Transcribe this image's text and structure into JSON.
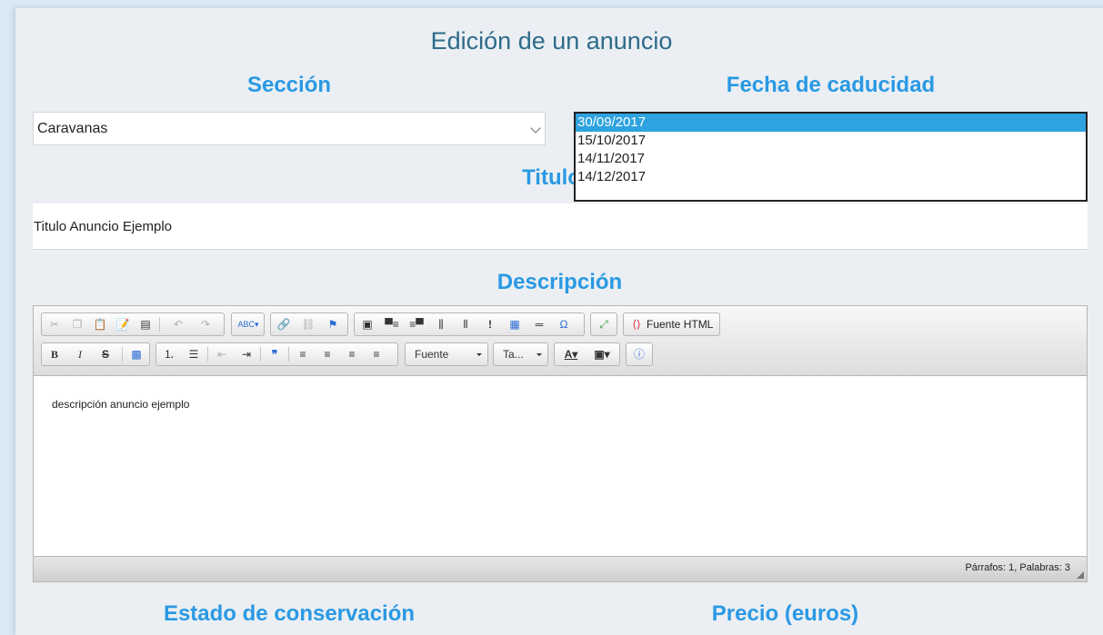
{
  "page_title": "Edición de un anuncio",
  "seccion": {
    "label": "Sección",
    "selected": "Caravanas"
  },
  "fecha": {
    "label": "Fecha de caducidad",
    "options": [
      "30/09/2017",
      "15/10/2017",
      "14/11/2017",
      "14/12/2017"
    ],
    "selected_index": 0
  },
  "titulo": {
    "label": "Titulo",
    "value": "Titulo Anuncio Ejemplo"
  },
  "descripcion": {
    "label": "Descripción",
    "source_button": "Fuente HTML",
    "font_combo": "Fuente",
    "size_combo": "Ta...",
    "content": "descripción anuncio ejemplo",
    "status": "Párrafos: 1, Palabras: 3"
  },
  "estado": {
    "label": "Estado de conservación"
  },
  "precio": {
    "label": "Precio (euros)"
  },
  "colors": {
    "heading": "#2a99e4",
    "title": "#2e6b8a",
    "selected_option": "#2ea3df",
    "panel": "#ebeff3"
  }
}
